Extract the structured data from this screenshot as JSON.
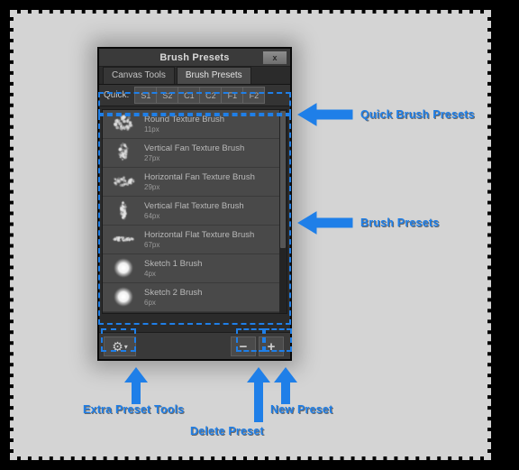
{
  "window": {
    "title": "Brush Presets",
    "close_label": "x"
  },
  "tabs": [
    {
      "label": "Canvas Tools",
      "active": false
    },
    {
      "label": "Brush Presets",
      "active": true
    }
  ],
  "quick": {
    "label": "Quick:",
    "buttons": [
      "S1",
      "S2",
      "C1",
      "C2",
      "F1",
      "F2"
    ]
  },
  "presets": [
    {
      "name": "Round Texture Brush",
      "size": "11px",
      "thumb": "scatter-round"
    },
    {
      "name": "Vertical Fan Texture Brush",
      "size": "27px",
      "thumb": "scatter-vfan"
    },
    {
      "name": "Horizontal Fan Texture Brush",
      "size": "29px",
      "thumb": "scatter-hfan"
    },
    {
      "name": "Vertical Flat Texture Brush",
      "size": "64px",
      "thumb": "scatter-vflat"
    },
    {
      "name": "Horizontal Flat Texture Brush",
      "size": "67px",
      "thumb": "scatter-hflat"
    },
    {
      "name": "Sketch 1 Brush",
      "size": "4px",
      "thumb": "soft-circle"
    },
    {
      "name": "Sketch 2 Brush",
      "size": "6px",
      "thumb": "soft-circle"
    }
  ],
  "toolbar": {
    "gear_label": "⚙",
    "gear_caret": "▾",
    "minus_label": "−",
    "plus_label": "+"
  },
  "annotations": [
    {
      "id": "quick-brush-presets",
      "text": "Quick Brush Presets"
    },
    {
      "id": "brush-presets",
      "text": "Brush Presets"
    },
    {
      "id": "extra-preset-tools",
      "text": "Extra Preset Tools"
    },
    {
      "id": "delete-preset",
      "text": "Delete Preset"
    },
    {
      "id": "new-preset",
      "text": "New Preset"
    }
  ],
  "colors": {
    "accent": "#1f7fe8",
    "page_background": "#d4d4d4",
    "panel_background": "#2b2b2b",
    "row_background": "#494949"
  }
}
